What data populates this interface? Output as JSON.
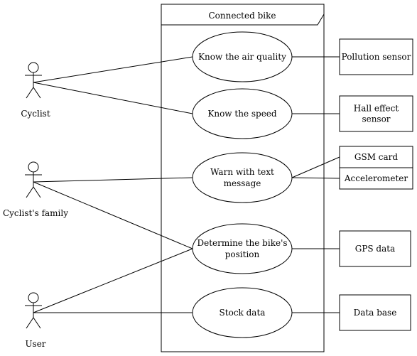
{
  "system": {
    "title": "Connected bike"
  },
  "actors": [
    {
      "id": "cyclist",
      "label": "Cyclist"
    },
    {
      "id": "family",
      "label": "Cyclist's family"
    },
    {
      "id": "user",
      "label": "User"
    }
  ],
  "use_cases": [
    {
      "id": "air",
      "lines": [
        "Know the air quality"
      ]
    },
    {
      "id": "speed",
      "lines": [
        "Know the speed"
      ]
    },
    {
      "id": "warn",
      "lines": [
        "Warn with text",
        "message"
      ]
    },
    {
      "id": "position",
      "lines": [
        "Determine the bike's",
        "position"
      ]
    },
    {
      "id": "stock",
      "lines": [
        "Stock data"
      ]
    }
  ],
  "external": [
    {
      "id": "pollution",
      "lines": [
        "Pollution sensor"
      ]
    },
    {
      "id": "hall",
      "lines": [
        "Hall effect",
        "sensor"
      ]
    },
    {
      "id": "gsm",
      "lines": [
        "GSM card"
      ]
    },
    {
      "id": "accel",
      "lines": [
        "Accelerometer"
      ]
    },
    {
      "id": "gps",
      "lines": [
        "GPS data"
      ]
    },
    {
      "id": "db",
      "lines": [
        "Data base"
      ]
    }
  ],
  "associations": [
    [
      "cyclist",
      "air"
    ],
    [
      "cyclist",
      "speed"
    ],
    [
      "family",
      "warn"
    ],
    [
      "family",
      "position"
    ],
    [
      "user",
      "position"
    ],
    [
      "user",
      "stock"
    ],
    [
      "air",
      "pollution"
    ],
    [
      "speed",
      "hall"
    ],
    [
      "warn",
      "gsm"
    ],
    [
      "warn",
      "accel"
    ],
    [
      "position",
      "gps"
    ],
    [
      "stock",
      "db"
    ]
  ]
}
